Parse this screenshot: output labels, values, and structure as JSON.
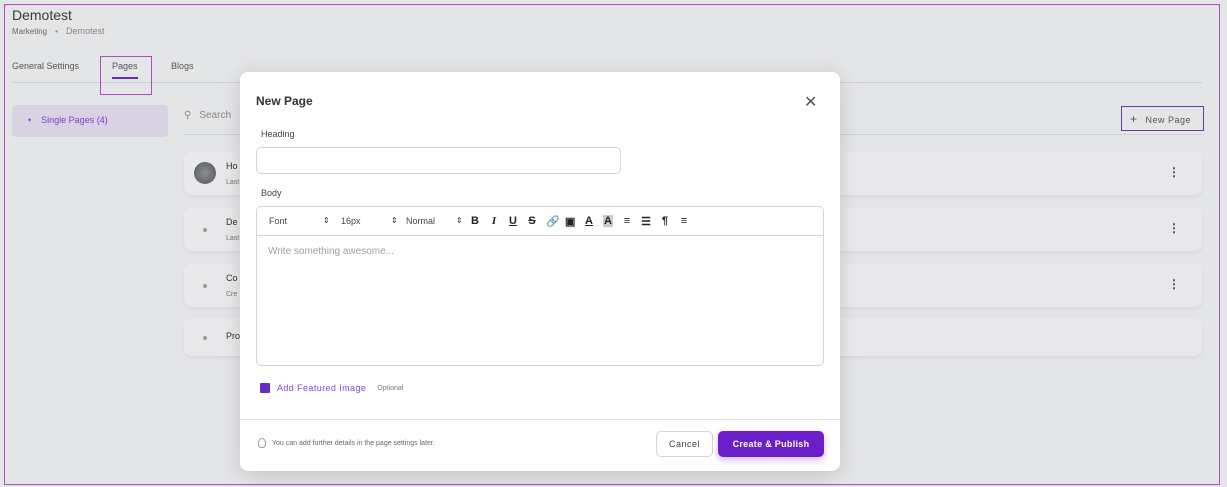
{
  "header": {
    "title": "Demotest",
    "breadcrumb": [
      "Marketing",
      "Demotest"
    ]
  },
  "tabs": [
    {
      "label": "General Settings"
    },
    {
      "label": "Pages",
      "active": true
    },
    {
      "label": "Blogs"
    }
  ],
  "sidebar": {
    "items": [
      {
        "label": "Single Pages (4)",
        "active": true
      }
    ]
  },
  "search": {
    "placeholder": "Search"
  },
  "new_page_button": "New Page",
  "rows": [
    {
      "title": "Ho",
      "subtitle": "Last",
      "has_avatar": true
    },
    {
      "title": "De",
      "subtitle": "Last"
    },
    {
      "title": "Co",
      "subtitle": "Cre"
    },
    {
      "title": "Pro",
      "subtitle": ""
    }
  ],
  "modal": {
    "title": "New Page",
    "heading_label": "Heading",
    "heading_value": "",
    "body_label": "Body",
    "toolbar": {
      "font": "Font",
      "size": "16px",
      "block": "Normal",
      "buttons": [
        "bold",
        "italic",
        "underline",
        "strikethrough",
        "link",
        "image",
        "text-color",
        "highlight",
        "ordered-list",
        "bullet-list",
        "rtl-paragraph",
        "align"
      ]
    },
    "body_placeholder": "Write something awesome...",
    "featured_image": "Add Featured Image",
    "optional": "Optional",
    "hint": "You can add further details in the page settings later.",
    "cancel": "Cancel",
    "create": "Create & Publish"
  },
  "colors": {
    "accent": "#6a1fc9",
    "highlight_border": "#b04cc0"
  }
}
